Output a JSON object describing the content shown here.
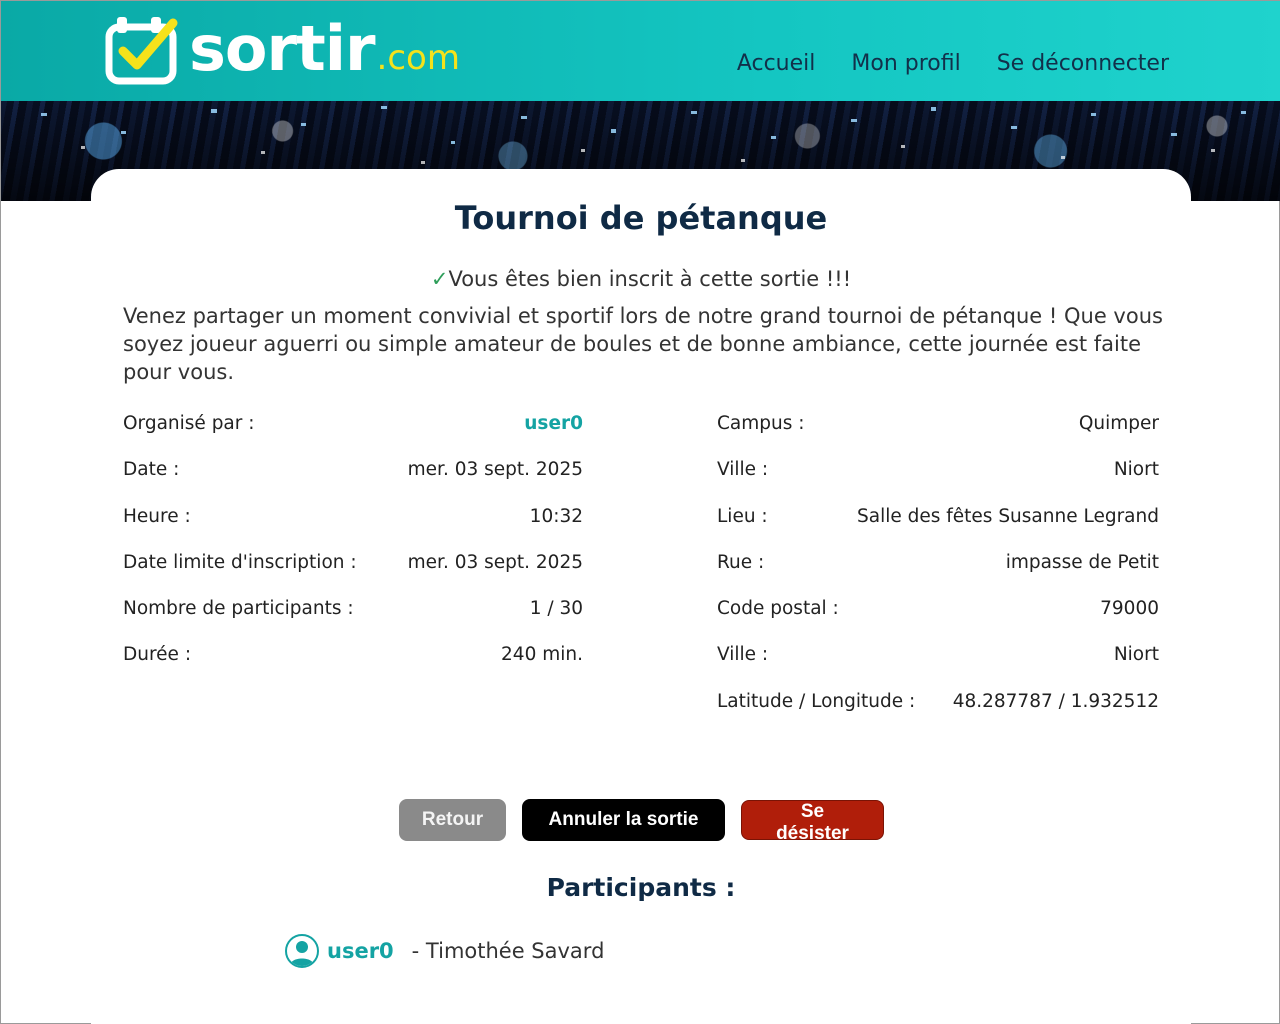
{
  "header": {
    "logo_main": "sortir",
    "logo_suffix": ".com",
    "nav": [
      "Accueil",
      "Mon profil",
      "Se déconnecter"
    ]
  },
  "colors": {
    "header_teal": "#14c6c2",
    "link_teal": "#14a3a3",
    "title_navy": "#0f2a45",
    "check_green": "#2e9e5a",
    "logo_yellow": "#f5e21b",
    "btn_grey": "#8a8a8a",
    "btn_black": "#000000",
    "btn_red": "#b01e0a"
  },
  "sortie": {
    "title": "Tournoi de pétanque",
    "check_glyph": "✓",
    "inscrit_message": "Vous êtes bien inscrit à cette sortie !!!",
    "description": "Venez partager un moment convivial et sportif lors de notre grand tournoi de pétanque ! Que vous soyez joueur aguerri ou simple amateur de boules et de bonne ambiance, cette journée est faite pour vous."
  },
  "details_left": [
    {
      "label": "Organisé par :",
      "value": "user0"
    },
    {
      "label": "Date :",
      "value": "mer. 03 sept. 2025"
    },
    {
      "label": "Heure :",
      "value": "10:32"
    },
    {
      "label": "Date limite d'inscription :",
      "value": "mer. 03 sept. 2025"
    },
    {
      "label": "Nombre de participants :",
      "value": "1 / 30"
    },
    {
      "label": "Durée :",
      "value": "240 min."
    }
  ],
  "details_right": [
    {
      "label": "Campus :",
      "value": "Quimper"
    },
    {
      "label": "Ville :",
      "value": "Niort"
    },
    {
      "label": "Lieu :",
      "value": "Salle des fêtes Susanne Legrand"
    },
    {
      "label": "Rue :",
      "value": "impasse de Petit"
    },
    {
      "label": "Code postal :",
      "value": "79000"
    },
    {
      "label": "Ville :",
      "value": "Niort"
    },
    {
      "label": "Latitude / Longitude :",
      "value": "48.287787 / 1.932512"
    }
  ],
  "buttons": {
    "retour": "Retour",
    "annuler": "Annuler la sortie",
    "desister": "Se désister"
  },
  "participants": {
    "title": "Participants :",
    "list": [
      {
        "username": "user0",
        "fullname": "- Timothée Savard",
        "icon": "user-avatar-icon"
      }
    ]
  }
}
